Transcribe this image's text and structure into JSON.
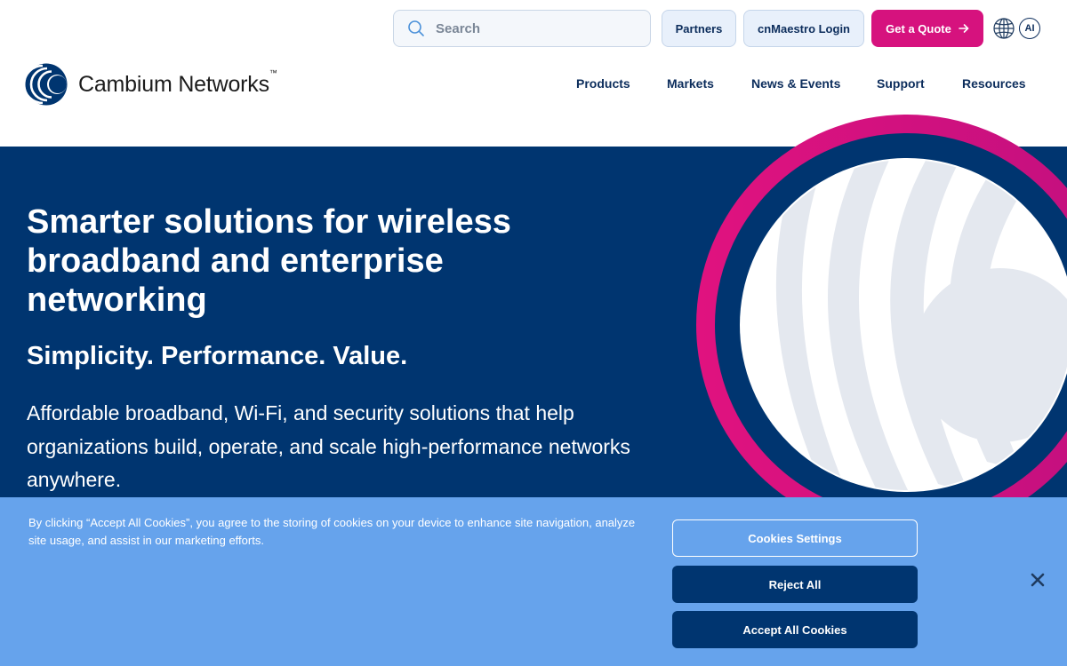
{
  "header": {
    "search_placeholder": "Search",
    "partners_label": "Partners",
    "login_label": "cnMaestro Login",
    "quote_label": "Get a Quote",
    "ai_label": "AI",
    "logo_text": "Cambium Networks",
    "logo_tm": "™"
  },
  "nav": {
    "items": [
      "Products",
      "Markets",
      "News & Events",
      "Support",
      "Resources"
    ]
  },
  "hero": {
    "title": "Smarter solutions for wireless broadband and enterprise networking",
    "subtitle": "Simplicity. Performance. Value.",
    "description": "Affordable broadband, Wi-Fi, and security solutions that help organizations build, operate, and scale high-performance networks anywhere."
  },
  "cookie": {
    "text": "By clicking “Accept All Cookies”, you agree to the storing of cookies on your device to enhance site navigation, analyze site usage, and assist in our marketing efforts.",
    "settings_label": "Cookies Settings",
    "reject_label": "Reject All",
    "accept_label": "Accept All Cookies"
  },
  "colors": {
    "navy": "#003570",
    "magenta": "#d6127e",
    "banner_blue": "#66a3ec",
    "nav_text": "#0c2d5c"
  },
  "icons": [
    "search-icon",
    "arrow-right-icon",
    "globe-icon",
    "close-icon",
    "cambium-logo-icon"
  ]
}
